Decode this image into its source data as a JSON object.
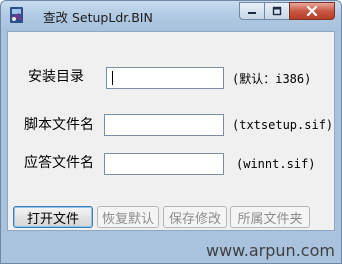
{
  "window": {
    "title": "查改 SetupLdr.BIN",
    "controls": {
      "minimize": "minimize-icon",
      "maximize": "maximize-icon",
      "close": "close-icon"
    }
  },
  "form": {
    "fields": [
      {
        "label": "安装目录",
        "value": "",
        "hint": "(默认：i386)"
      },
      {
        "label": "脚本文件名",
        "value": "",
        "hint": "(txtsetup.sif)"
      },
      {
        "label": "应答文件名",
        "value": "",
        "hint": "(winnt.sif)"
      }
    ]
  },
  "buttons": {
    "open_file": "打开文件",
    "restore_default": "恢复默认",
    "save_changes": "保存修改",
    "owning_folder": "所属文件夹"
  },
  "watermark": "www.arpun.com",
  "colors": {
    "frame": "#a9c3de",
    "client": "#f0f0f0",
    "close_button": "#c75a45"
  }
}
